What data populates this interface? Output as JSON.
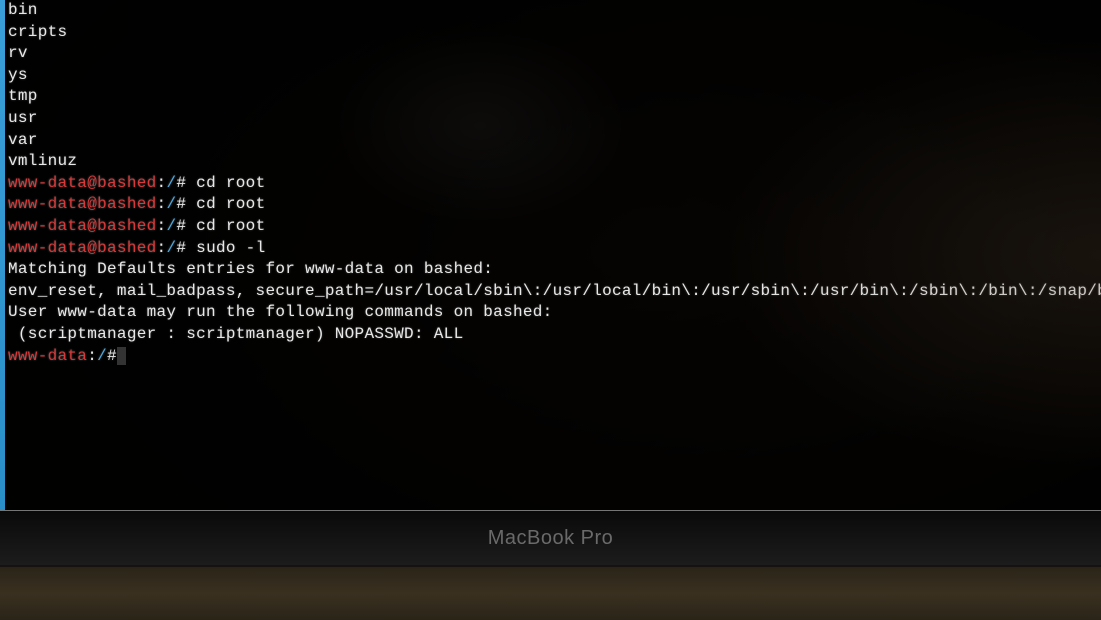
{
  "colors": {
    "user": "#d93838",
    "path": "#4aa8e0",
    "text": "#e8e8e8",
    "background": "#000000"
  },
  "listing": {
    "l0": "bin",
    "l1": "cripts",
    "l2": "rv",
    "l3": "ys",
    "l4": "tmp",
    "l5": "usr",
    "l6": "var",
    "l7": "vmlinuz"
  },
  "prompts": {
    "p1": {
      "user": "www-data",
      "at": "@",
      "host": "bashed",
      "sep": ":",
      "path": "/",
      "hash": "#",
      "cmd": " cd root"
    },
    "p2": {
      "user": "www-data",
      "at": "@",
      "host": "bashed",
      "sep": ":",
      "path": "/",
      "hash": "#",
      "cmd": " cd root"
    },
    "p3": {
      "user": "www-data",
      "at": "@",
      "host": "bashed",
      "sep": ":",
      "path": "/",
      "hash": "#",
      "cmd": " cd root"
    },
    "p4": {
      "user": "www-data",
      "at": "@",
      "host": "bashed",
      "sep": ":",
      "path": "/",
      "hash": "#",
      "cmd": " sudo -l"
    },
    "p5": {
      "user": "www-data",
      "sep": ":",
      "path": "/",
      "hash": "#",
      "cmd": ""
    }
  },
  "sudo_output": {
    "o1": "Matching Defaults entries for www-data on bashed:",
    "o2": "env_reset, mail_badpass, secure_path=/usr/local/sbin\\:/usr/local/bin\\:/usr/sbin\\:/usr/bin\\:/sbin\\:/bin\\:/snap/bin",
    "o3": "",
    "o4": "User www-data may run the following commands on bashed:",
    "o5": " (scriptmanager : scriptmanager) NOPASSWD: ALL"
  },
  "device_label": "MacBook Pro"
}
